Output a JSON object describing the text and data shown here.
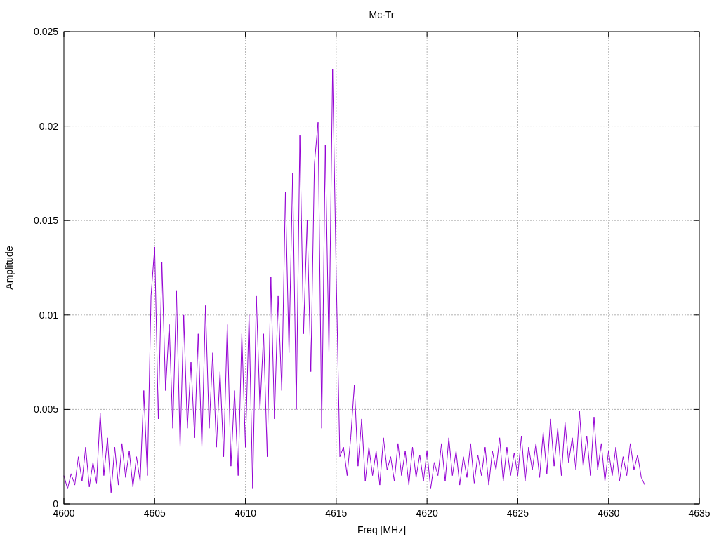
{
  "plot": {
    "chart_data": {
      "type": "line",
      "title": "Mc-Tr",
      "xlabel": "Freq [MHz]",
      "ylabel": "Amplitude",
      "x": [
        4600,
        4600.2,
        4600.4,
        4600.6,
        4600.8,
        4601,
        4601.2,
        4601.4,
        4601.6,
        4601.8,
        4602,
        4602.2,
        4602.4,
        4602.6,
        4602.8,
        4603,
        4603.2,
        4603.4,
        4603.6,
        4603.8,
        4604,
        4604.2,
        4604.4,
        4604.6,
        4604.8,
        4605,
        4605.2,
        4605.4,
        4605.6,
        4605.8,
        4606,
        4606.2,
        4606.4,
        4606.6,
        4606.8,
        4607,
        4607.2,
        4607.4,
        4607.6,
        4607.8,
        4608,
        4608.2,
        4608.4,
        4608.6,
        4608.8,
        4609,
        4609.2,
        4609.4,
        4609.6,
        4609.8,
        4610,
        4610.2,
        4610.4,
        4610.6,
        4610.8,
        4611,
        4611.2,
        4611.4,
        4611.6,
        4611.8,
        4612,
        4612.2,
        4612.4,
        4612.6,
        4612.8,
        4613,
        4613.2,
        4613.4,
        4613.6,
        4613.8,
        4614,
        4614.2,
        4614.4,
        4614.6,
        4614.8,
        4615,
        4615.2,
        4615.4,
        4615.6,
        4615.8,
        4616,
        4616.2,
        4616.4,
        4616.6,
        4616.8,
        4617,
        4617.2,
        4617.4,
        4617.6,
        4617.8,
        4618,
        4618.2,
        4618.4,
        4618.6,
        4618.8,
        4619,
        4619.2,
        4619.4,
        4619.6,
        4619.8,
        4620,
        4620.2,
        4620.4,
        4620.6,
        4620.8,
        4621,
        4621.2,
        4621.4,
        4621.6,
        4621.8,
        4622,
        4622.2,
        4622.4,
        4622.6,
        4622.8,
        4623,
        4623.2,
        4623.4,
        4623.6,
        4623.8,
        4624,
        4624.2,
        4624.4,
        4624.6,
        4624.8,
        4625,
        4625.2,
        4625.4,
        4625.6,
        4625.8,
        4626,
        4626.2,
        4626.4,
        4626.6,
        4626.8,
        4627,
        4627.2,
        4627.4,
        4627.6,
        4627.8,
        4628,
        4628.2,
        4628.4,
        4628.6,
        4628.8,
        4629,
        4629.2,
        4629.4,
        4629.6,
        4629.8,
        4630,
        4630.2,
        4630.4,
        4630.6,
        4630.8,
        4631,
        4631.2,
        4631.4,
        4631.6,
        4631.8,
        4632
      ],
      "series": [
        {
          "color": "#9400d3",
          "values": [
            0.0015,
            0.0008,
            0.0016,
            0.001,
            0.0025,
            0.0012,
            0.003,
            0.0009,
            0.0022,
            0.0011,
            0.0048,
            0.0015,
            0.0035,
            0.0006,
            0.003,
            0.001,
            0.0032,
            0.0014,
            0.0028,
            0.0009,
            0.0025,
            0.0012,
            0.006,
            0.0015,
            0.011,
            0.0136,
            0.0045,
            0.0128,
            0.006,
            0.0095,
            0.004,
            0.0113,
            0.003,
            0.01,
            0.004,
            0.0075,
            0.0035,
            0.009,
            0.003,
            0.0105,
            0.004,
            0.008,
            0.003,
            0.007,
            0.0025,
            0.0095,
            0.002,
            0.006,
            0.0015,
            0.009,
            0.003,
            0.01,
            0.0008,
            0.011,
            0.005,
            0.009,
            0.0025,
            0.012,
            0.0045,
            0.011,
            0.006,
            0.0165,
            0.008,
            0.0175,
            0.005,
            0.0195,
            0.009,
            0.015,
            0.007,
            0.018,
            0.0202,
            0.004,
            0.019,
            0.008,
            0.023,
            0.012,
            0.0025,
            0.003,
            0.0015,
            0.0035,
            0.0063,
            0.002,
            0.0045,
            0.0012,
            0.003,
            0.0015,
            0.0028,
            0.001,
            0.0035,
            0.0018,
            0.0025,
            0.0012,
            0.0032,
            0.0015,
            0.0028,
            0.001,
            0.003,
            0.0014,
            0.0026,
            0.0012,
            0.0028,
            0.0008,
            0.0022,
            0.0015,
            0.0032,
            0.0012,
            0.0035,
            0.0015,
            0.0028,
            0.001,
            0.0025,
            0.0014,
            0.0032,
            0.0011,
            0.0026,
            0.0015,
            0.003,
            0.001,
            0.0028,
            0.0018,
            0.0035,
            0.0012,
            0.003,
            0.0015,
            0.0027,
            0.0015,
            0.0036,
            0.0012,
            0.003,
            0.0018,
            0.0032,
            0.0014,
            0.0038,
            0.0016,
            0.0045,
            0.002,
            0.004,
            0.0015,
            0.0043,
            0.0022,
            0.0035,
            0.0018,
            0.0049,
            0.002,
            0.0036,
            0.0015,
            0.0046,
            0.0018,
            0.0032,
            0.0012,
            0.0028,
            0.0015,
            0.003,
            0.0012,
            0.0025,
            0.0015,
            0.0032,
            0.0018,
            0.0026,
            0.0014,
            0.001
          ]
        }
      ],
      "grid": true,
      "xlim": [
        4600,
        4635
      ],
      "ylim": [
        0,
        0.025
      ],
      "xticks": [
        4600,
        4605,
        4610,
        4615,
        4620,
        4625,
        4630,
        4635
      ],
      "yticks": [
        0,
        0.005,
        0.01,
        0.015,
        0.02,
        0.025
      ]
    }
  }
}
